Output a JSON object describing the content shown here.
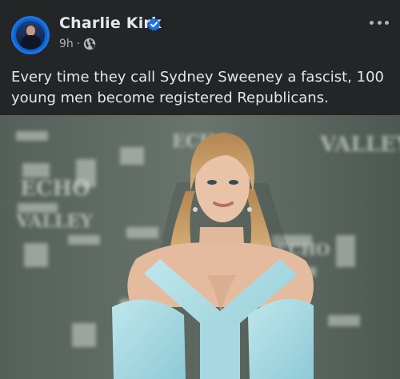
{
  "post": {
    "author": "Charlie Kirk",
    "verified": true,
    "time": "9h",
    "separator": "·",
    "privacy_icon": "globe-icon",
    "more_icon": "more-options-icon",
    "text": "Every time they call Sydney Sweeney a fascist, 100 young men become registered Republicans."
  },
  "image": {
    "description_icon": "photo",
    "backdrop_words": [
      "ECHO",
      "VALLEY"
    ]
  },
  "colors": {
    "background": "#242526",
    "text": "#e4e6eb",
    "secondary_text": "#b0b3b8",
    "verified_blue": "#1b74e4",
    "dress": "#a9d9e2"
  }
}
